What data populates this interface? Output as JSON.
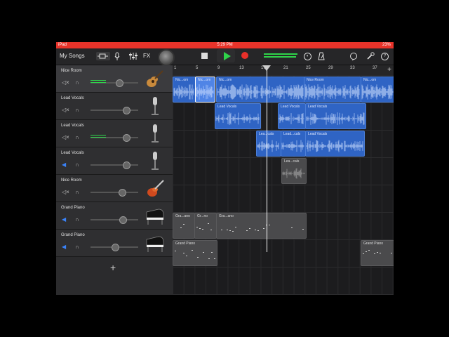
{
  "status": {
    "carrier": "iPad",
    "time": "5:29 PM",
    "battery": "23%"
  },
  "toolbar": {
    "my_songs": "My Songs",
    "fx": "FX",
    "accent": "#2fd44a",
    "record_color": "#e8302a"
  },
  "tracks": [
    {
      "name": "Nice Room",
      "muted": false,
      "level": 0.35,
      "instrument": "acoustic-guitar-icon",
      "selected": true
    },
    {
      "name": "Lead Vocals",
      "muted": false,
      "level": 0.0,
      "instrument": "microphone-icon",
      "selected": false
    },
    {
      "name": "Lead Vocals",
      "muted": false,
      "level": 0.35,
      "instrument": "microphone-icon",
      "selected": false
    },
    {
      "name": "Lead Vocals",
      "muted": true,
      "level": 0.0,
      "instrument": "microphone-icon",
      "selected": false
    },
    {
      "name": "Nice Room",
      "muted": false,
      "level": 0.0,
      "instrument": "electric-guitar-icon",
      "selected": false
    },
    {
      "name": "Grand Piano",
      "muted": true,
      "level": 0.0,
      "instrument": "grand-piano-icon",
      "selected": false
    },
    {
      "name": "Grand Piano",
      "muted": true,
      "level": 0.0,
      "instrument": "grand-piano-icon",
      "selected": false
    }
  ],
  "ruler": [
    "1",
    "5",
    "9",
    "13",
    "17",
    "21",
    "25",
    "29",
    "33",
    "37"
  ],
  "regions": {
    "r1a": "Nic...om",
    "r1b": "Nic...om",
    "r1c": "Nic...om",
    "r1d": "Nice Room",
    "r1e": "Nic...om",
    "r2a": "Lead Vocals",
    "r2b": "Lead Vocals",
    "r2c": "Lead Vocals",
    "r3a": "Lea...cals",
    "r3b": "Lead...cals",
    "r3c": "Lead Vocals",
    "r4a": "Lea...cals",
    "r6a": "Gra...ano",
    "r6b": "Gr...no",
    "r6c": "Gra...ano",
    "r7a": "Grand Piano",
    "r7b": "Grand Piano"
  },
  "add_track": "+"
}
